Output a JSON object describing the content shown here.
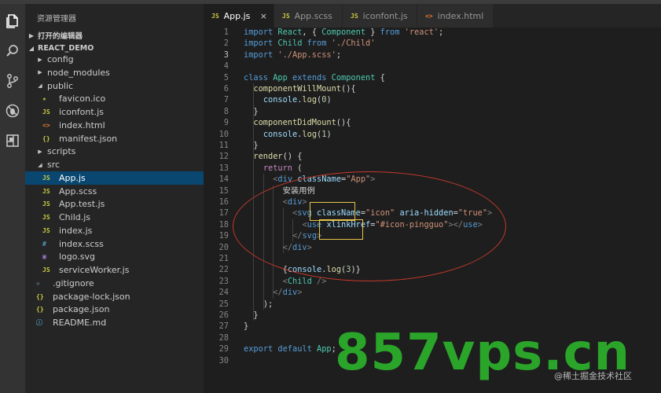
{
  "sidebar": {
    "title": "资源管理器",
    "sections": {
      "open_editors": "打开的编辑器",
      "project": "REACT_DEMO"
    },
    "tree": [
      {
        "label": "config",
        "icon": "folder-closed",
        "depth": 1,
        "type": "folder"
      },
      {
        "label": "node_modules",
        "icon": "folder-closed",
        "depth": 1,
        "type": "folder"
      },
      {
        "label": "public",
        "icon": "folder-open",
        "depth": 1,
        "type": "folder"
      },
      {
        "label": "favicon.ico",
        "icon": "star-icon",
        "depth": 2,
        "type": "ico"
      },
      {
        "label": "iconfont.js",
        "icon": "JS",
        "depth": 2,
        "type": "js"
      },
      {
        "label": "index.html",
        "icon": "<>",
        "depth": 2,
        "type": "html"
      },
      {
        "label": "manifest.json",
        "icon": "{}",
        "depth": 2,
        "type": "json"
      },
      {
        "label": "scripts",
        "icon": "folder-closed",
        "depth": 1,
        "type": "folder"
      },
      {
        "label": "src",
        "icon": "folder-open",
        "depth": 1,
        "type": "folder"
      },
      {
        "label": "App.js",
        "icon": "JS",
        "depth": 2,
        "type": "js",
        "selected": true
      },
      {
        "label": "App.scss",
        "icon": "JS",
        "depth": 2,
        "type": "js"
      },
      {
        "label": "App.test.js",
        "icon": "JS",
        "depth": 2,
        "type": "js"
      },
      {
        "label": "Child.js",
        "icon": "JS",
        "depth": 2,
        "type": "js"
      },
      {
        "label": "index.js",
        "icon": "JS",
        "depth": 2,
        "type": "js"
      },
      {
        "label": "index.scss",
        "icon": "#",
        "depth": 2,
        "type": "css"
      },
      {
        "label": "logo.svg",
        "icon": "svg",
        "depth": 2,
        "type": "svg"
      },
      {
        "label": "serviceWorker.js",
        "icon": "JS",
        "depth": 2,
        "type": "js"
      },
      {
        "label": ".gitignore",
        "icon": "git-diamond-icon",
        "depth": 1,
        "type": "git"
      },
      {
        "label": "package-lock.json",
        "icon": "{}",
        "depth": 1,
        "type": "json"
      },
      {
        "label": "package.json",
        "icon": "{}",
        "depth": 1,
        "type": "json"
      },
      {
        "label": "README.md",
        "icon": "info-icon",
        "depth": 1,
        "type": "info"
      }
    ]
  },
  "tabs": [
    {
      "label": "App.js",
      "icon": "JS",
      "active": true,
      "close": "×"
    },
    {
      "label": "App.scss",
      "icon": "JS",
      "active": false
    },
    {
      "label": "iconfont.js",
      "icon": "JS",
      "active": false
    },
    {
      "label": "index.html",
      "icon": "<>",
      "active": false
    }
  ],
  "editor": {
    "current_line": 3,
    "lines": [
      "import React, { Component } from 'react';",
      "import Child from './Child'",
      "import './App.scss';",
      "",
      "class App extends Component {",
      "  componentWillMount(){",
      "    console.log(0)",
      "  }",
      "  componentDidMount(){",
      "    console.log(1)",
      "  }",
      "  render() {",
      "    return (",
      "      <div className=\"App\">",
      "        安装用例",
      "        <div>",
      "          <svg className=\"icon\" aria-hidden=\"true\">",
      "            <use xlinkHref=\"#icon-pingguo\"></use>",
      "          </svg>",
      "        </div>",
      "",
      "        {console.log(3)}",
      "        <Child />",
      "      </div>",
      "    );",
      "  }",
      "}",
      "",
      "export default App;",
      ""
    ]
  },
  "watermark": {
    "big": "857vps.cn",
    "small": "@稀土掘金技术社区"
  },
  "colors": {
    "selection": "#094771",
    "annotation_red": "#c0392b",
    "annotation_yellow": "#e6c34a"
  }
}
